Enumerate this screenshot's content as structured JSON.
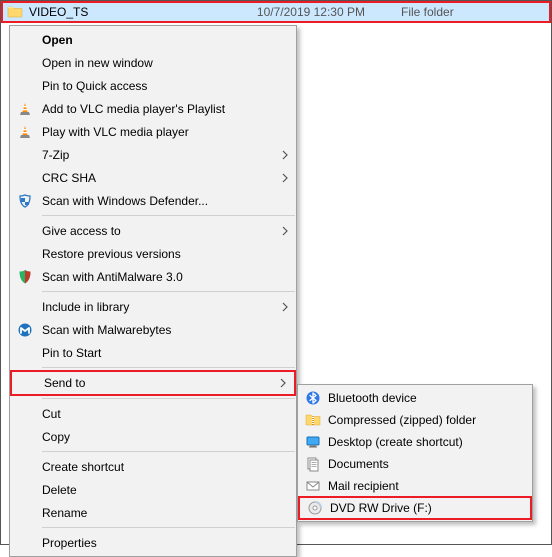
{
  "file_row": {
    "name": "VIDEO_TS",
    "date": "10/7/2019 12:30 PM",
    "type": "File folder"
  },
  "context_menu": {
    "open": "Open",
    "open_new_window": "Open in new window",
    "pin_quick_access": "Pin to Quick access",
    "vlc_playlist": "Add to VLC media player's Playlist",
    "vlc_play": "Play with VLC media player",
    "seven_zip": "7-Zip",
    "crc_sha": "CRC SHA",
    "scan_defender": "Scan with Windows Defender...",
    "give_access": "Give access to",
    "restore_versions": "Restore previous versions",
    "scan_antimalware": "Scan with AntiMalware 3.0",
    "include_library": "Include in library",
    "scan_malwarebytes": "Scan with Malwarebytes",
    "pin_start": "Pin to Start",
    "send_to": "Send to",
    "cut": "Cut",
    "copy": "Copy",
    "create_shortcut": "Create shortcut",
    "delete": "Delete",
    "rename": "Rename",
    "properties": "Properties"
  },
  "submenu": {
    "bluetooth": "Bluetooth device",
    "compressed": "Compressed (zipped) folder",
    "desktop_shortcut": "Desktop (create shortcut)",
    "documents": "Documents",
    "mail": "Mail recipient",
    "dvd_rw": "DVD RW Drive (F:)"
  }
}
